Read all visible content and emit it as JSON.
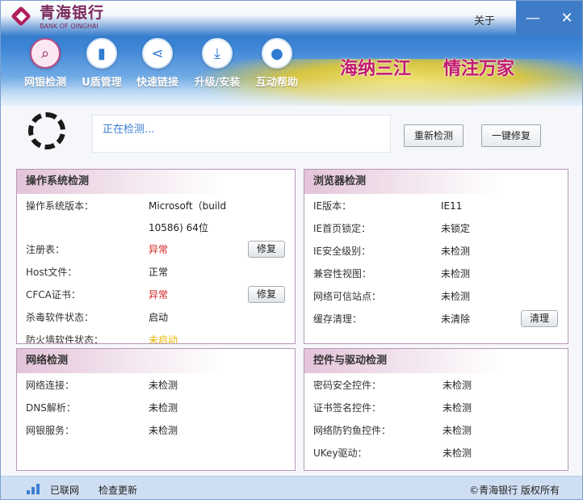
{
  "brand": {
    "name_cn": "青海银行",
    "name_en": "BANK OF QINGHAI"
  },
  "titlebar": {
    "about": "关于",
    "minimize": "—",
    "close": "✕"
  },
  "nav": [
    {
      "label": "网银检测",
      "icon": "magnifier-icon",
      "glyph": "⌕"
    },
    {
      "label": "U盾管理",
      "icon": "usb-key-icon",
      "glyph": "▮"
    },
    {
      "label": "快速链接",
      "icon": "share-icon",
      "glyph": "⋖"
    },
    {
      "label": "升级/安装",
      "icon": "download-icon",
      "glyph": "⤓"
    },
    {
      "label": "互动帮助",
      "icon": "user-help-icon",
      "glyph": "●"
    }
  ],
  "slogan": {
    "left": "海纳三江",
    "right": "情注万家"
  },
  "status": {
    "text": "正在检测...",
    "recheck": "重新检测",
    "fix_all": "一键修复"
  },
  "os_panel": {
    "title": "操作系统检测",
    "version_label": "操作系统版本：",
    "version_line1": "Microsoft（build",
    "version_line2": "10586) 64位",
    "registry_label": "注册表：",
    "registry_value": "异常",
    "registry_btn": "修复",
    "hosts_label": "Host文件：",
    "hosts_value": "正常",
    "cfca_label": "CFCA证书：",
    "cfca_value": "异常",
    "cfca_btn": "修复",
    "av_label": "杀毒软件状态：",
    "av_value": "启动",
    "fw_label": "防火墙软件状态：",
    "fw_value": "未启动"
  },
  "browser_panel": {
    "title": "浏览器检测",
    "ie_label": "IE版本：",
    "ie_value": "IE11",
    "home_label": "IE首页锁定：",
    "home_value": "未锁定",
    "sec_label": "IE安全级别：",
    "sec_value": "未检测",
    "compat_label": "兼容性视图：",
    "compat_value": "未检测",
    "trust_label": "网络可信站点：",
    "trust_value": "未检测",
    "cache_label": "缓存清理：",
    "cache_value": "未清除",
    "cache_btn": "清理"
  },
  "network_panel": {
    "title": "网络检测",
    "conn_label": "网络连接：",
    "conn_value": "未检测",
    "dns_label": "DNS解析：",
    "dns_value": "未检测",
    "bank_label": "网银服务：",
    "bank_value": "未检测"
  },
  "control_panel": {
    "title": "控件与驱动检测",
    "pwd_label": "密码安全控件：",
    "pwd_value": "未检测",
    "cert_label": "证书签名控件：",
    "cert_value": "未检测",
    "phish_label": "网络防钓鱼控件：",
    "phish_value": "未检测",
    "ukey_label": "UKey驱动：",
    "ukey_value": "未检测"
  },
  "footer": {
    "network": "已联网",
    "update": "检查更新",
    "copyright": "©青海银行 版权所有"
  },
  "colors": {
    "accent": "#c2186f",
    "error": "#d42222",
    "warning": "#e8b400",
    "link": "#3a7ed0"
  }
}
